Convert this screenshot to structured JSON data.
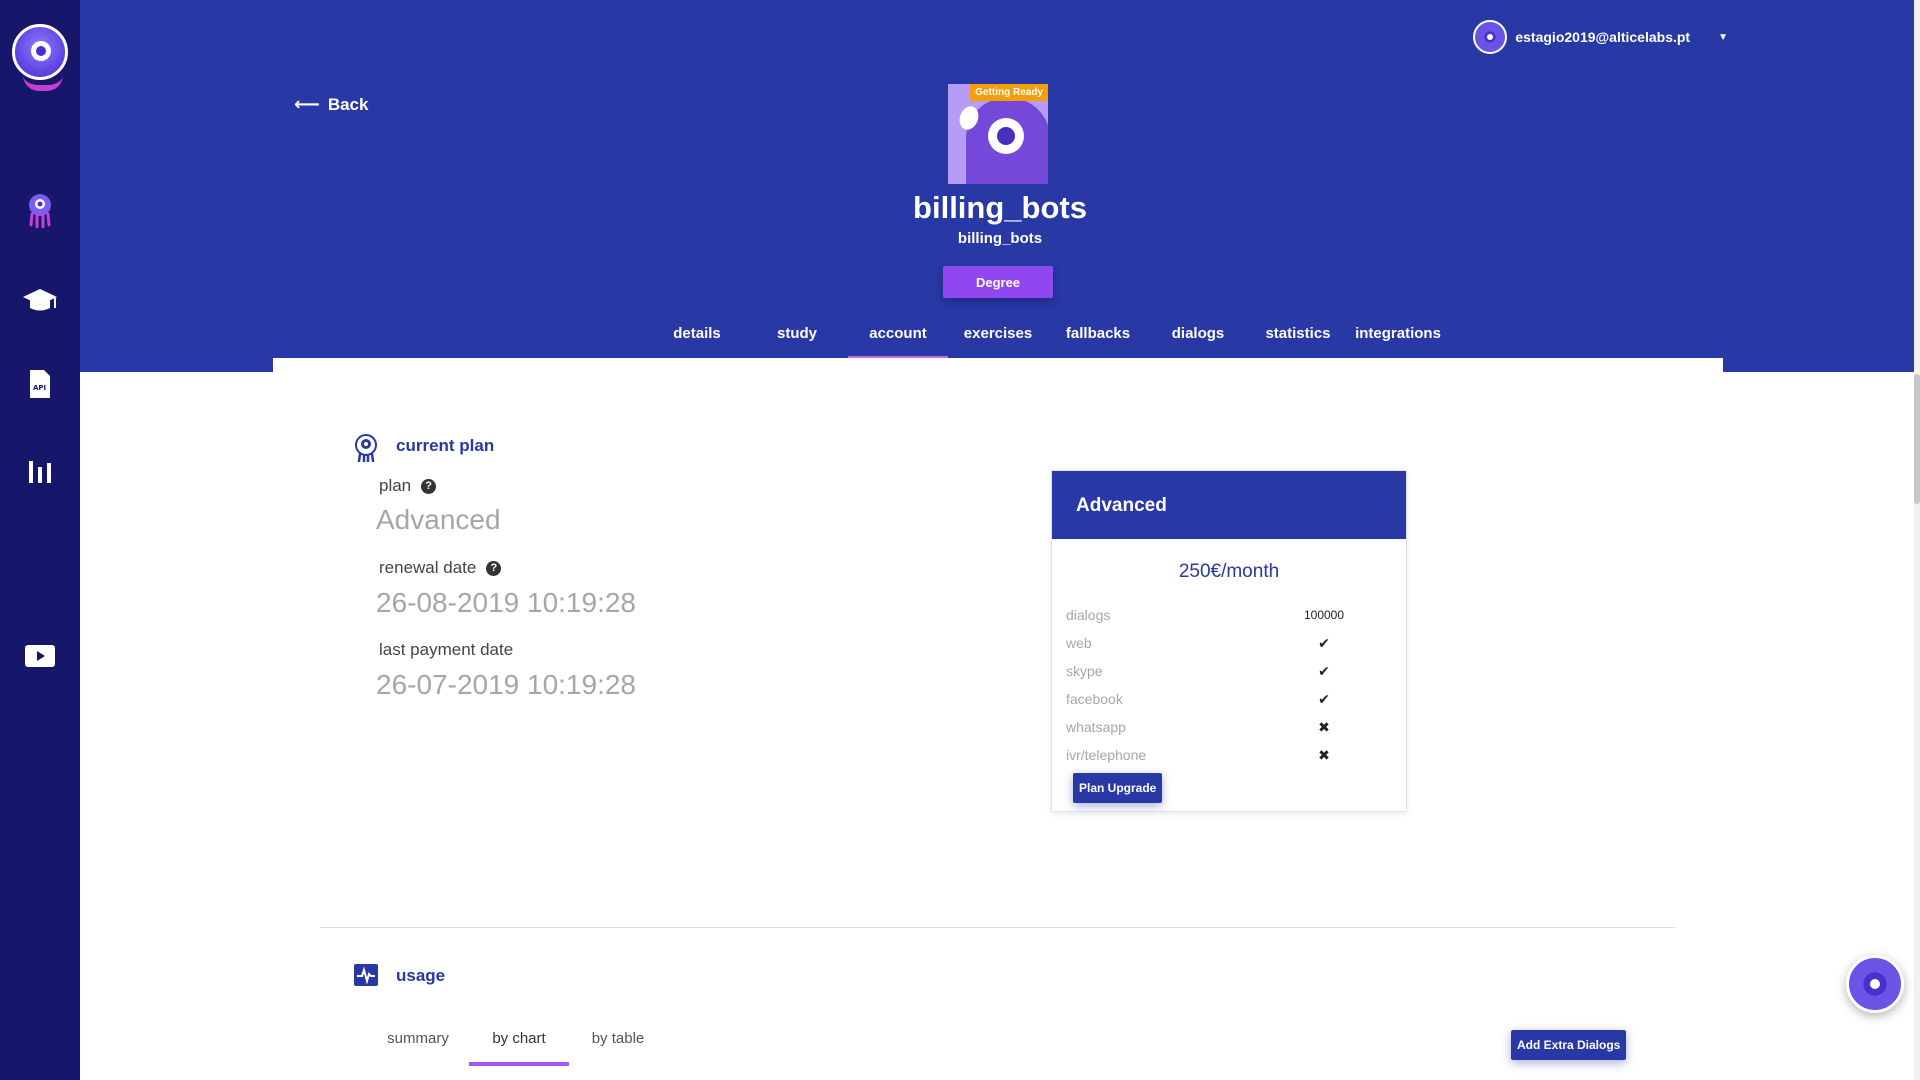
{
  "app": {
    "brand_color": "#2838a4",
    "sidebar_color": "#16166b",
    "accent": "#9147f0"
  },
  "sidebar": {
    "items": [
      {
        "name": "bots",
        "icon": "octopus-icon"
      },
      {
        "name": "academy",
        "icon": "graduation-cap-icon"
      },
      {
        "name": "api",
        "icon": "api-doc-icon"
      },
      {
        "name": "statistics",
        "icon": "bar-chart-icon"
      },
      {
        "name": "videos",
        "icon": "play-icon"
      }
    ]
  },
  "header": {
    "user_email": "estagio2019@alticelabs.pt",
    "back_label": "Back",
    "status_badge": "Getting Ready",
    "bot_name": "billing_bots",
    "bot_subname": "billing_bots",
    "degree_label": "Degree",
    "tabs": [
      "details",
      "study",
      "account",
      "exercises",
      "fallbacks",
      "dialogs",
      "statistics",
      "integrations"
    ],
    "active_tab": "account"
  },
  "current_plan": {
    "title": "current plan",
    "plan_label": "plan",
    "plan_value": "Advanced",
    "renewal_label": "renewal date",
    "renewal_value": "26-08-2019 10:19:28",
    "last_payment_label": "last payment date",
    "last_payment_value": "26-07-2019 10:19:28"
  },
  "plan_card": {
    "name": "Advanced",
    "price": "250€/month",
    "features": [
      {
        "label": "dialogs",
        "value": "100000"
      },
      {
        "label": "web",
        "value": "✔"
      },
      {
        "label": "skype",
        "value": "✔"
      },
      {
        "label": "facebook",
        "value": "✔"
      },
      {
        "label": "whatsapp",
        "value": "✖"
      },
      {
        "label": "ivr/telephone",
        "value": "✖"
      }
    ],
    "upgrade_label": "Plan Upgrade"
  },
  "usage": {
    "title": "usage",
    "tabs": [
      "summary",
      "by chart",
      "by table"
    ],
    "active_tab": "by chart",
    "extra_dialogs_label": "Add Extra Dialogs"
  }
}
